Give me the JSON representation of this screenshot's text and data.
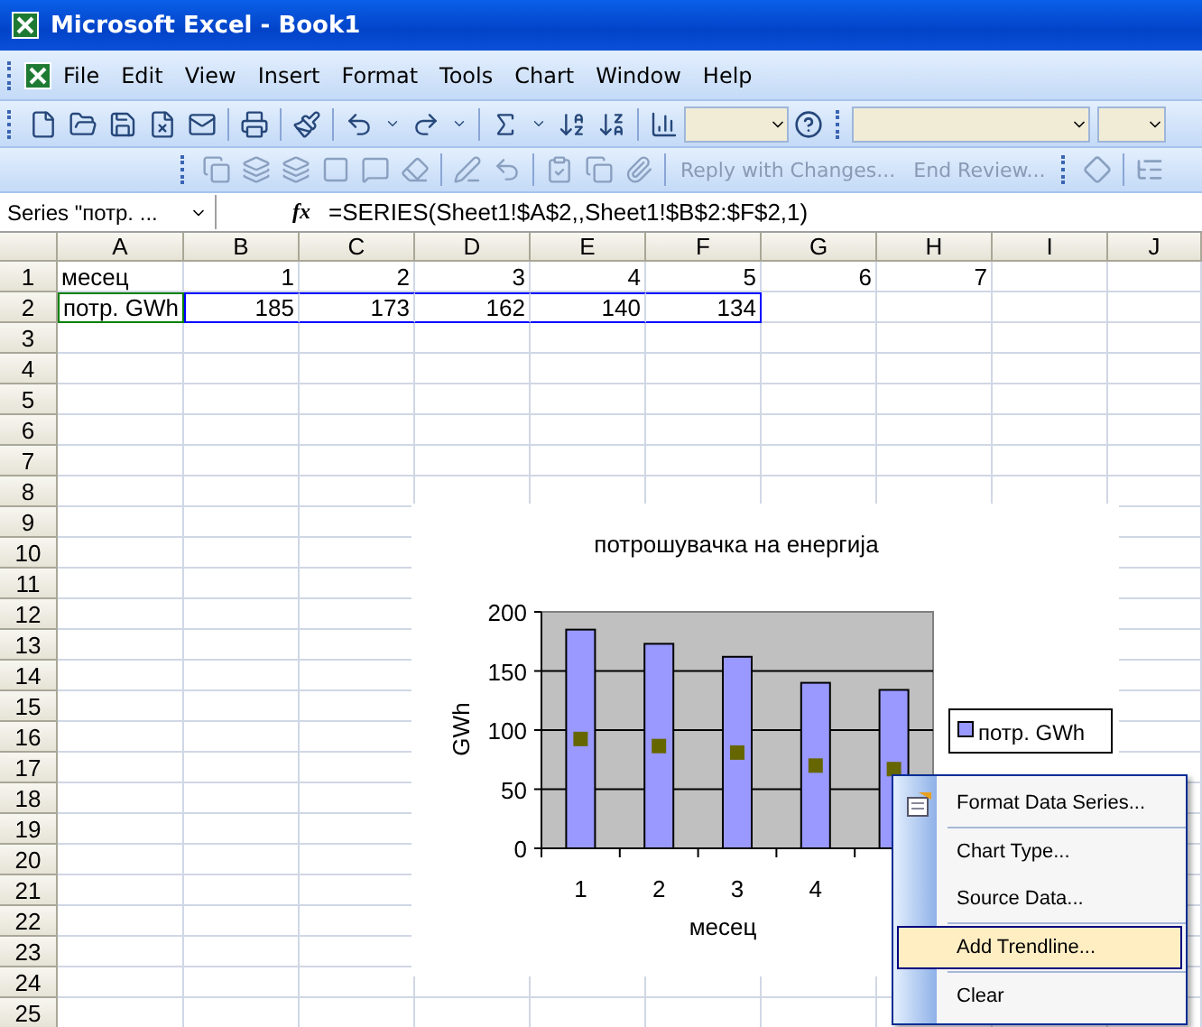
{
  "window": {
    "title": "Microsoft Excel - Book1"
  },
  "menu": [
    "File",
    "Edit",
    "View",
    "Insert",
    "Format",
    "Tools",
    "Chart",
    "Window",
    "Help"
  ],
  "review_toolbar": [
    {
      "label": "Reply with Changes...",
      "disabled": true
    },
    {
      "label": "End Review...",
      "disabled": true
    }
  ],
  "formula_bar": {
    "name_box": "Series \"потр. ...",
    "fx": "fx",
    "formula": "=SERIES(Sheet1!$A$2,,Sheet1!$B$2:$F$2,1)"
  },
  "sheet": {
    "columns": [
      "A",
      "B",
      "C",
      "D",
      "E",
      "F",
      "G",
      "H",
      "I",
      "J"
    ],
    "rows": [
      {
        "label": "1",
        "cells": [
          {
            "text": "месец",
            "kind": "text"
          },
          {
            "text": "1",
            "kind": "number"
          },
          {
            "text": "2",
            "kind": "number"
          },
          {
            "text": "3",
            "kind": "number"
          },
          {
            "text": "4",
            "kind": "number"
          },
          {
            "text": "5",
            "kind": "number"
          },
          {
            "text": "6",
            "kind": "number"
          },
          {
            "text": "7",
            "kind": "number"
          }
        ]
      },
      {
        "label": "2",
        "cells": [
          {
            "text": "потр. GWh",
            "kind": "text",
            "color": "#008000"
          },
          {
            "text": "185",
            "kind": "number",
            "color": "#0000ff"
          },
          {
            "text": "173",
            "kind": "number",
            "color": "#0000ff"
          },
          {
            "text": "162",
            "kind": "number",
            "color": "#0000ff"
          },
          {
            "text": "140",
            "kind": "number",
            "color": "#0000ff"
          },
          {
            "text": "134",
            "kind": "number",
            "color": "#0000ff"
          }
        ]
      },
      {
        "label": "3"
      },
      {
        "label": "4"
      },
      {
        "label": "5"
      },
      {
        "label": "6"
      },
      {
        "label": "7"
      },
      {
        "label": "8"
      },
      {
        "label": "9"
      },
      {
        "label": "10"
      },
      {
        "label": "11"
      },
      {
        "label": "12"
      },
      {
        "label": "13"
      },
      {
        "label": "14"
      },
      {
        "label": "15"
      },
      {
        "label": "16"
      },
      {
        "label": "17"
      },
      {
        "label": "18"
      },
      {
        "label": "19"
      },
      {
        "label": "20"
      },
      {
        "label": "21"
      },
      {
        "label": "22"
      },
      {
        "label": "23"
      },
      {
        "label": "24"
      },
      {
        "label": "25"
      }
    ]
  },
  "chart": {
    "series_selected": true,
    "chart_data": {
      "type": "bar",
      "title": "потрошувачка на енергија",
      "xlabel": "месец",
      "ylabel": "GWh",
      "categories": [
        "1",
        "2",
        "3",
        "4",
        null
      ],
      "ylim": [
        0,
        200
      ],
      "yticks": [
        0,
        50,
        100,
        150,
        200
      ],
      "grid": true,
      "series": [
        {
          "name": "потр. GWh",
          "color": "#9999ff",
          "values": [
            185,
            173,
            162,
            140,
            134
          ]
        }
      ]
    }
  },
  "context_menu": [
    {
      "label": "Format Data Series...",
      "selected": false,
      "icon": true
    },
    {
      "label": "Chart Type...",
      "selected": false
    },
    {
      "label": "Source Data...",
      "selected": false
    },
    {
      "label": "Add Trendline...",
      "selected": true
    },
    {
      "label": "Clear",
      "selected": false
    }
  ]
}
